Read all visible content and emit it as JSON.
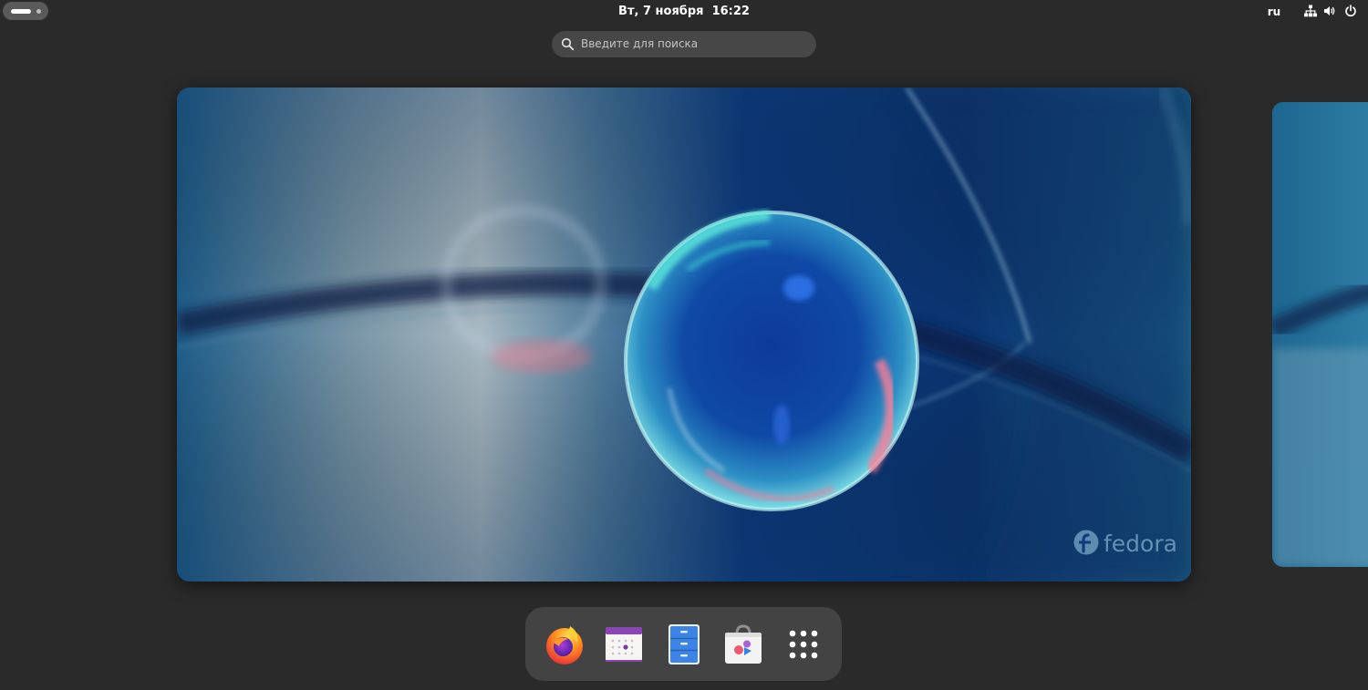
{
  "topbar": {
    "clock": "Вт, 7 ноября  16:22",
    "language": "ru",
    "indicators": [
      "network-icon",
      "volume-icon",
      "power-icon"
    ]
  },
  "search": {
    "placeholder": "Введите для поиска"
  },
  "workspace": {
    "wallpaper_logo_text": "fedora"
  },
  "dock": {
    "apps": [
      {
        "name": "firefox",
        "icon": "firefox-icon"
      },
      {
        "name": "calendar",
        "icon": "calendar-icon"
      },
      {
        "name": "files",
        "icon": "file-cabinet-icon"
      },
      {
        "name": "software",
        "icon": "software-bag-icon"
      },
      {
        "name": "show-apps",
        "icon": "app-grid-icon"
      }
    ]
  },
  "colors": {
    "panel": "#2a2a2a",
    "dock": "#434343",
    "search_field": "#474747",
    "wallpaper_deep_blue": "#0f3c7d"
  }
}
